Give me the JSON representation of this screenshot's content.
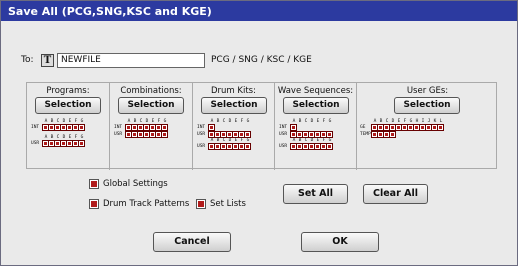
{
  "window": {
    "title": "Save All (PCG,SNG,KSC and KGE)"
  },
  "to": {
    "label": "To:",
    "t_button": "T",
    "filename": "NEWFILE",
    "suffix": "PCG / SNG / KSC / KGE"
  },
  "columns": {
    "programs": {
      "title": "Programs:",
      "button": "Selection",
      "bank_letters": [
        "A",
        "B",
        "C",
        "D",
        "E",
        "F",
        "G"
      ],
      "rows": [
        "INT",
        "USR"
      ]
    },
    "combinations": {
      "title": "Combinations:",
      "button": "Selection",
      "bank_letters": [
        "A",
        "B",
        "C",
        "D",
        "E",
        "F",
        "G"
      ],
      "rows": [
        "INT",
        "USR"
      ]
    },
    "drum_kits": {
      "title": "Drum Kits:",
      "button": "Selection",
      "bank_letters": [
        "A",
        "B",
        "C",
        "D",
        "E",
        "F",
        "G"
      ],
      "rows": [
        "INT",
        "USR"
      ]
    },
    "wave_sequences": {
      "title": "Wave Sequences:",
      "button": "Selection",
      "bank_letters": [
        "A",
        "B",
        "C",
        "D",
        "E",
        "F",
        "G"
      ],
      "rows": [
        "INT",
        "USR"
      ]
    },
    "user_ges": {
      "title": "User GEs:",
      "button": "Selection",
      "bank_letters": [
        "A",
        "B",
        "C",
        "D",
        "E",
        "F",
        "G",
        "H",
        "I",
        "J",
        "K",
        "L"
      ],
      "rows": [
        "GE",
        "TEMPLATE"
      ]
    }
  },
  "options": {
    "global_settings": "Global Settings",
    "drum_track_patterns": "Drum Track Patterns",
    "set_lists": "Set Lists"
  },
  "buttons": {
    "set_all": "Set All",
    "clear_all": "Clear All",
    "cancel": "Cancel",
    "ok": "OK"
  },
  "colors": {
    "titlebar": "#2c3aa0",
    "checked": "#b01b1b",
    "dialog_bg": "#eaeaea"
  }
}
